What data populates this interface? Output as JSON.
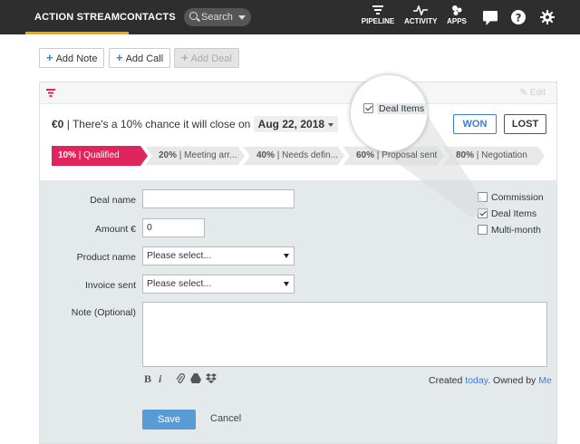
{
  "nav": {
    "tabs": [
      "ACTION STREAM",
      "CONTACTS"
    ],
    "search_placeholder": "Search",
    "icons": [
      {
        "label": "PIPELINE",
        "icon": "funnel-icon"
      },
      {
        "label": "ACTIVITY",
        "icon": "pulse-icon"
      },
      {
        "label": "APPS",
        "icon": "apps-icon"
      }
    ],
    "right_icons": [
      "chat-icon",
      "help-icon",
      "gear-icon"
    ]
  },
  "actions": {
    "add_note": "Add Note",
    "add_call": "Add Call",
    "add_deal": "Add Deal"
  },
  "deal": {
    "edit": "Edit",
    "amount": "€0",
    "chance_text": "There's a 10% chance it will close on",
    "close_date": "Aug 22, 2018",
    "won": "WON",
    "lost": "LOST",
    "stages": [
      {
        "pct": "10%",
        "name": "Qualified",
        "active": true
      },
      {
        "pct": "20%",
        "name": "Meeting arr..."
      },
      {
        "pct": "40%",
        "name": "Needs defin..."
      },
      {
        "pct": "60%",
        "name": "Proposal sent"
      },
      {
        "pct": "80%",
        "name": "Negotiation"
      }
    ]
  },
  "form": {
    "deal_name_label": "Deal name",
    "deal_name_value": "",
    "amount_label": "Amount €",
    "amount_value": "0",
    "product_label": "Product name",
    "product_value": "Please select...",
    "invoice_label": "Invoice sent",
    "invoice_value": "Please select...",
    "note_label": "Note (Optional)",
    "toolbar": [
      "bold-icon",
      "italic-icon",
      "attach-icon",
      "drive-icon",
      "dropbox-icon"
    ],
    "created_label": "Created",
    "created_value": "today.",
    "owned_label": "Owned by",
    "owned_value": "Me",
    "checkboxes": [
      {
        "label": "Commission",
        "checked": false
      },
      {
        "label": "Deal Items",
        "checked": true
      },
      {
        "label": "Multi-month",
        "checked": false
      }
    ],
    "save": "Save",
    "cancel": "Cancel"
  },
  "callout": {
    "label": "Deal Items",
    "checked": true
  },
  "colors": {
    "nav_bg": "#2e2e2e",
    "accent": "#f2a900",
    "active_stage": "#e0245e",
    "link": "#3a7fd5"
  }
}
